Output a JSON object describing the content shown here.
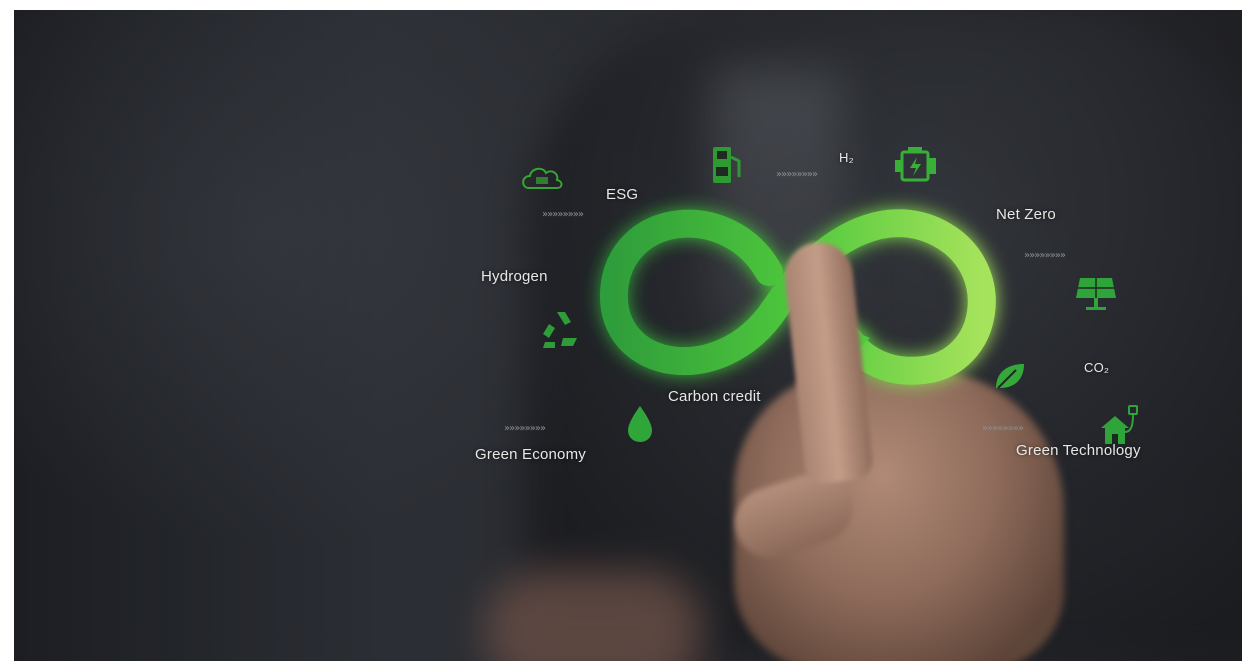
{
  "labels": {
    "esg": "ESG",
    "h2": "H₂",
    "net_zero": "Net Zero",
    "hydrogen": "Hydrogen",
    "co2": "CO₂",
    "carbon_credit": "Carbon credit",
    "green_economy": "Green Economy",
    "green_technology": "Green Technology"
  },
  "chevrons": "»»»»»»»»",
  "icons": {
    "cloud": "co2-cloud-icon",
    "fuel": "hydrogen-fuel-station-icon",
    "engine": "electric-engine-icon",
    "solar": "solar-panel-icon",
    "recycle": "recycle-icon",
    "leaf": "leaf-icon",
    "drop": "water-drop-icon",
    "house": "green-house-plug-icon",
    "infinity": "infinity-loop-icon"
  },
  "colors": {
    "accent": "#4fc83c",
    "accent_light": "#8ee05a",
    "background": "#222428"
  }
}
